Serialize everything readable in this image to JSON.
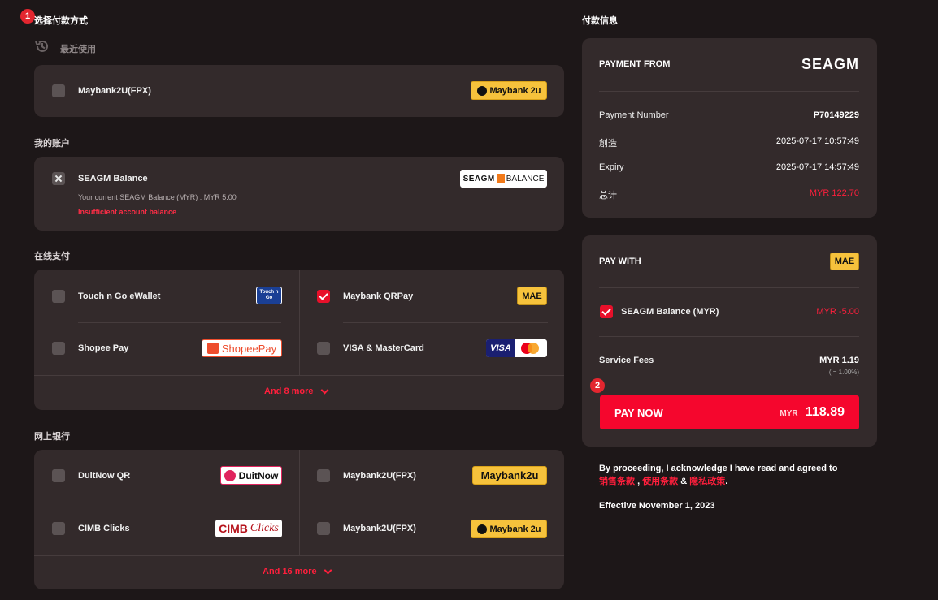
{
  "markers": {
    "one": "1",
    "two": "2"
  },
  "left": {
    "heading": "选择付款方式",
    "recent": {
      "label": "最近使用",
      "item": {
        "label": "Maybank2U(FPX)",
        "logo": "Maybank 2u"
      }
    },
    "account": {
      "title": "我的账户",
      "item": {
        "label": "SEAGM Balance",
        "current": "Your current SEAGM Balance (MYR) : MYR 5.00",
        "warning": "Insufficient account balance",
        "logo_left": "SEAGM",
        "logo_right": "BALANCE"
      }
    },
    "online": {
      "title": "在线支付",
      "items": [
        {
          "label": "Touch n Go eWallet",
          "logo": "Touch n Go",
          "checked": false
        },
        {
          "label": "Maybank QRPay",
          "logo": "MAE",
          "checked": true
        },
        {
          "label": "Shopee Pay",
          "logo": "ShopeePay",
          "checked": false
        },
        {
          "label": "VISA & MasterCard",
          "logo": "VISA",
          "checked": false
        }
      ],
      "more": "And 8 more"
    },
    "banking": {
      "title": "网上银行",
      "items": [
        {
          "label": "DuitNow QR",
          "logo": "DuitNow"
        },
        {
          "label": "Maybank2U(FPX)",
          "logo": "Maybank2u"
        },
        {
          "label": "CIMB Clicks",
          "logo_a": "CIMB",
          "logo_b": "Clicks"
        },
        {
          "label": "Maybank2U(FPX)",
          "logo": "Maybank 2u"
        }
      ],
      "more": "And 16 more"
    }
  },
  "right": {
    "heading": "付款信息",
    "payment_from": {
      "title": "PAYMENT FROM",
      "brand": "SEAGM",
      "rows": [
        {
          "label": "Payment Number",
          "value": "P70149229"
        },
        {
          "label": "創造",
          "value": "2025-07-17 10:57:49"
        },
        {
          "label": "Expiry",
          "value": "2025-07-17 14:57:49"
        },
        {
          "label": "总计",
          "value": "MYR 122.70"
        }
      ]
    },
    "pay_with": {
      "title": "PAY WITH",
      "logo": "MAE",
      "balance_label": "SEAGM Balance (MYR)",
      "balance_value": "MYR -5.00",
      "fees_label": "Service Fees",
      "fees_value": "MYR 1.19",
      "fees_note": "( = 1.00%)",
      "button_label": "PAY NOW",
      "button_currency": "MYR",
      "button_amount": "118.89"
    },
    "legal": {
      "line1": "By proceeding, I acknowledge I have read and agreed to",
      "link1": "销售条款",
      "sep1": ",",
      "link2": "使用条款",
      "sep2": "&",
      "link3": "隐私政策",
      "end": ".",
      "effective": "Effective November 1, 2023"
    }
  },
  "colors": {
    "accent": "#ff1f3c",
    "card": "#332a2b",
    "bg": "#1d1718",
    "button": "#f5062d"
  }
}
